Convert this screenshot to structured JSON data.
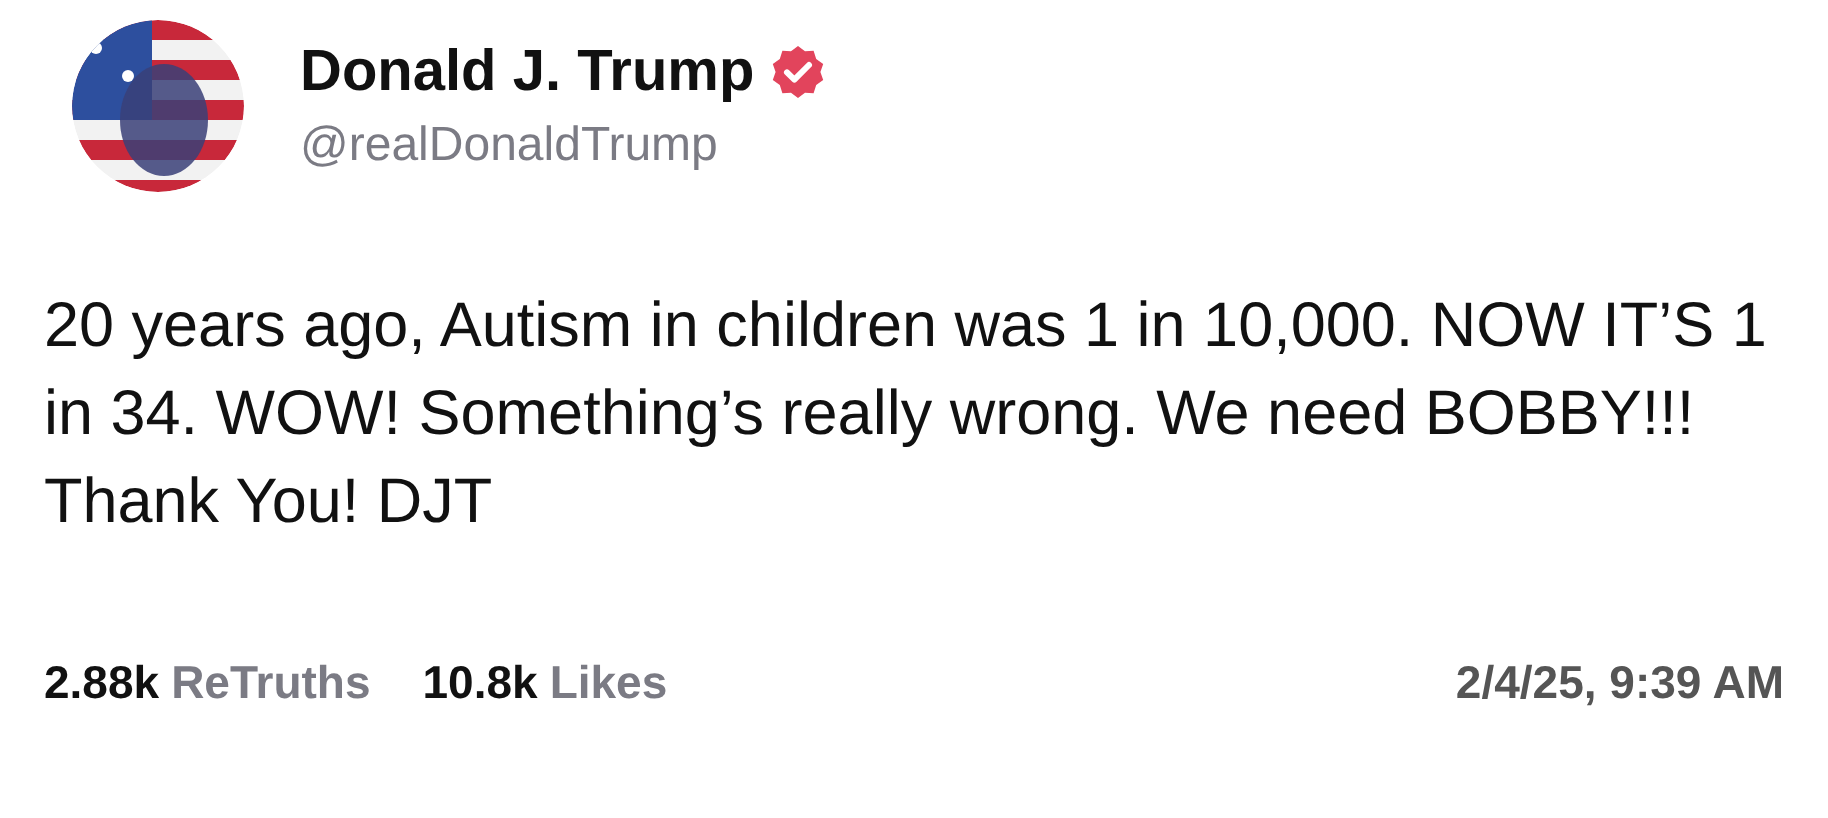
{
  "author": {
    "name": "Donald J. Trump",
    "handle": "@realDonaldTrump",
    "verified": true
  },
  "text": "20 years ago, Autism in children was 1 in 10,000. NOW IT’S 1 in 34. WOW! Something’s really wrong. We need BOBBY!!! Thank You! DJT",
  "stats": [
    {
      "count": "2.88k",
      "label": "ReTruths"
    },
    {
      "count": "10.8k",
      "label": "Likes"
    }
  ],
  "timestamp": "2/4/25, 9:39 AM"
}
